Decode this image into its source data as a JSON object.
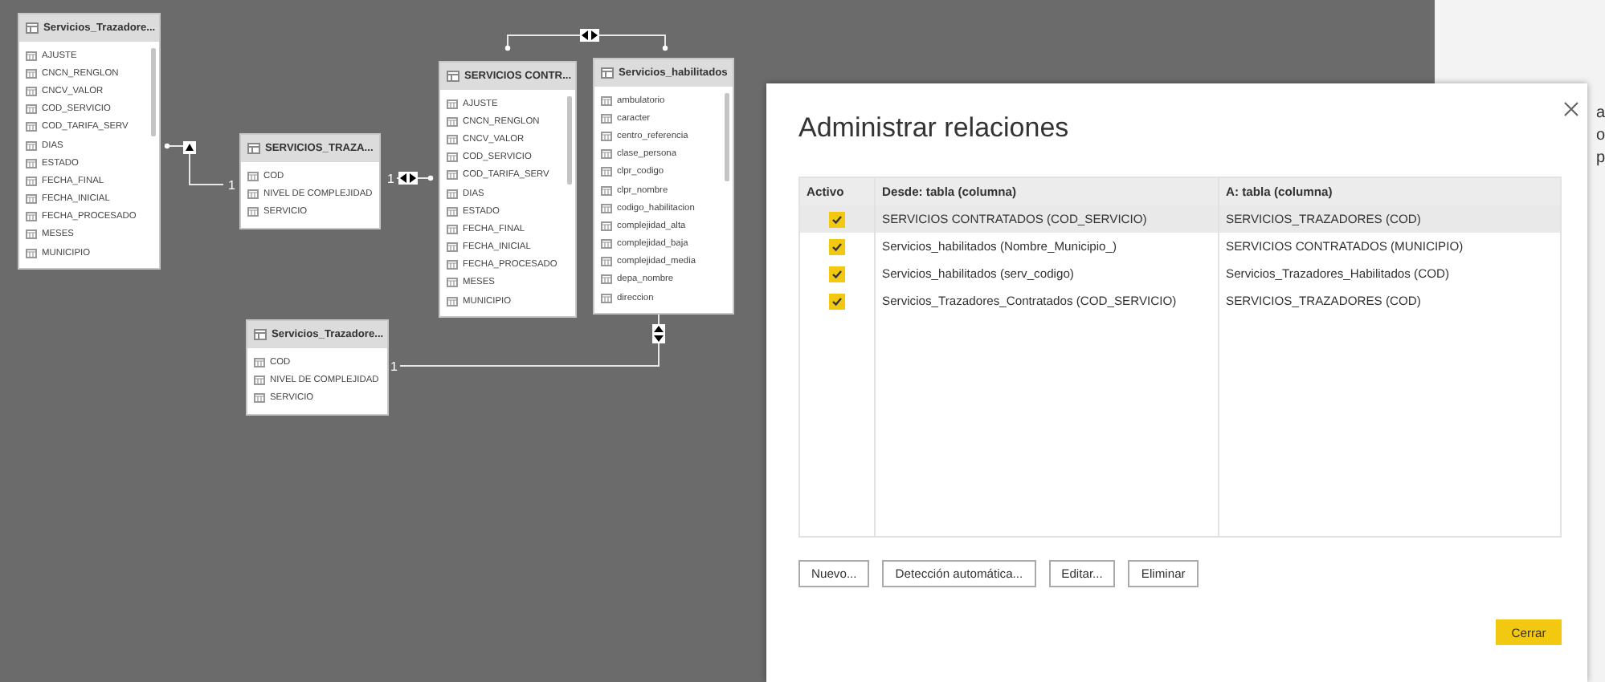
{
  "canvas": {
    "tables": [
      {
        "title": "Servicios_Trazadore...",
        "scrollbar": true,
        "columns": [
          "AJUSTE",
          "CNCN_RENGLON",
          "CNCV_VALOR",
          "COD_SERVICIO",
          "COD_TARIFA_SERV",
          "DIAS",
          "ESTADO",
          "FECHA_FINAL",
          "FECHA_INICIAL",
          "FECHA_PROCESADO",
          "MESES",
          "MUNICIPIO"
        ]
      },
      {
        "title": "SERVICIOS_TRAZA...",
        "scrollbar": false,
        "columns": [
          "COD",
          "NIVEL DE COMPLEJIDAD",
          "SERVICIO"
        ]
      },
      {
        "title": "SERVICIOS CONTR...",
        "scrollbar": true,
        "columns": [
          "AJUSTE",
          "CNCN_RENGLON",
          "CNCV_VALOR",
          "COD_SERVICIO",
          "COD_TARIFA_SERV",
          "DIAS",
          "ESTADO",
          "FECHA_FINAL",
          "FECHA_INICIAL",
          "FECHA_PROCESADO",
          "MESES",
          "MUNICIPIO"
        ]
      },
      {
        "title": "Servicios_habilitados",
        "scrollbar": true,
        "columns": [
          "ambulatorio",
          "caracter",
          "centro_referencia",
          "clase_persona",
          "clpr_codigo",
          "clpr_nombre",
          "codigo_habilitacion",
          "complejidad_alta",
          "complejidad_baja",
          "complejidad_media",
          "depa_nombre",
          "direccion"
        ]
      },
      {
        "title": "Servicios_Trazadore...",
        "scrollbar": false,
        "columns": [
          "COD",
          "NIVEL DE COMPLEJIDAD",
          "SERVICIO"
        ]
      }
    ],
    "relationships": [
      {
        "kind": "single",
        "label": "1"
      },
      {
        "kind": "both",
        "label": "1"
      },
      {
        "kind": "both"
      },
      {
        "kind": "vertical",
        "label": "1"
      }
    ]
  },
  "side_panel": {
    "texts": [
      "a",
      "o",
      "p"
    ]
  },
  "dialog": {
    "title": "Administrar relaciones",
    "columns": [
      "Activo",
      "Desde: tabla (columna)",
      "A: tabla (columna)"
    ],
    "rows": [
      {
        "active": true,
        "selected": true,
        "from": "SERVICIOS CONTRATADOS (COD_SERVICIO)",
        "to": "SERVICIOS_TRAZADORES (COD)"
      },
      {
        "active": true,
        "selected": false,
        "from": "Servicios_habilitados (Nombre_Municipio_)",
        "to": "SERVICIOS CONTRATADOS (MUNICIPIO)"
      },
      {
        "active": true,
        "selected": false,
        "from": "Servicios_habilitados (serv_codigo)",
        "to": "Servicios_Trazadores_Habilitados (COD)"
      },
      {
        "active": true,
        "selected": false,
        "from": "Servicios_Trazadores_Contratados (COD_SERVICIO)",
        "to": "SERVICIOS_TRAZADORES (COD)"
      }
    ],
    "buttons": [
      "Nuevo...",
      "Detección automática...",
      "Editar...",
      "Eliminar"
    ],
    "close_button": "Cerrar"
  }
}
